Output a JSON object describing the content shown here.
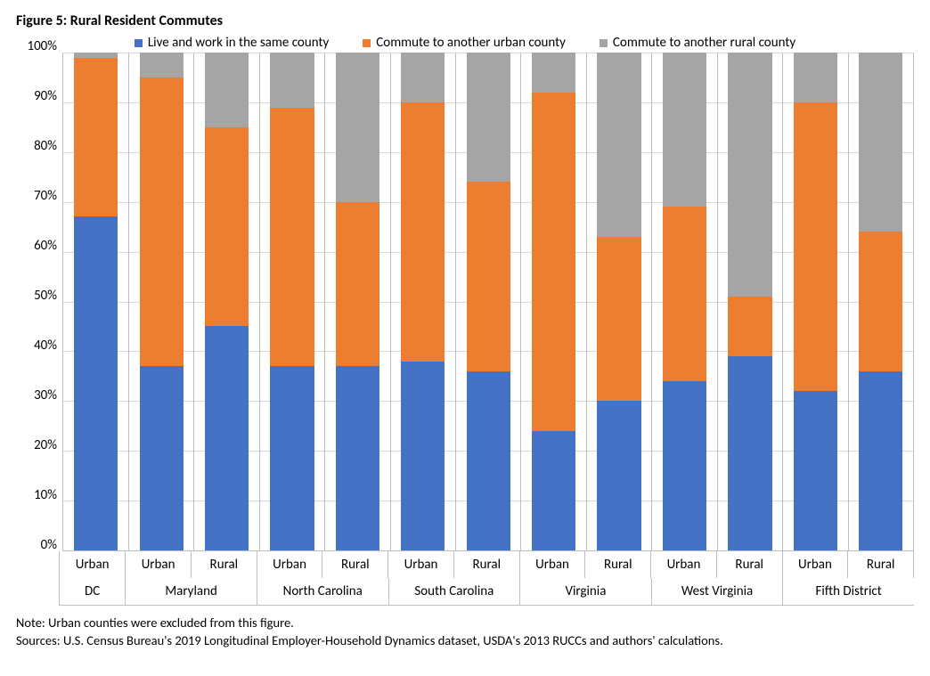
{
  "title": "Figure 5: Rural Resident Commutes",
  "legend": [
    {
      "label": "Live and work in the same county",
      "color": "#4472C4",
      "class": "c-blue"
    },
    {
      "label": "Commute to another urban county",
      "color": "#ED7D31",
      "class": "c-orange"
    },
    {
      "label": "Commute to another rural county",
      "color": "#A5A5A5",
      "class": "c-gray"
    }
  ],
  "y_ticks": [
    "100%",
    "90%",
    "80%",
    "70%",
    "60%",
    "50%",
    "40%",
    "30%",
    "20%",
    "10%",
    "0%"
  ],
  "note": "Note: Urban counties were excluded from this figure.",
  "source": "Sources: U.S. Census Bureau's 2019 Longitudinal Employer-Household Dynamics dataset, USDA's 2013 RUCCs and authors' calculations.",
  "chart_data": {
    "type": "bar",
    "stacked": true,
    "ylabel": "",
    "xlabel": "",
    "ylim": [
      0,
      100
    ],
    "series_names": [
      "Live and work in the same county",
      "Commute to another urban county",
      "Commute to another rural county"
    ],
    "groups": [
      {
        "state": "DC",
        "bars": [
          {
            "sub": "Urban",
            "values": [
              67,
              32,
              1
            ]
          }
        ]
      },
      {
        "state": "Maryland",
        "bars": [
          {
            "sub": "Urban",
            "values": [
              37,
              58,
              5
            ]
          },
          {
            "sub": "Rural",
            "values": [
              45,
              40,
              15
            ]
          }
        ]
      },
      {
        "state": "North Carolina",
        "bars": [
          {
            "sub": "Urban",
            "values": [
              37,
              52,
              11
            ]
          },
          {
            "sub": "Rural",
            "values": [
              37,
              33,
              30
            ]
          }
        ]
      },
      {
        "state": "South Carolina",
        "bars": [
          {
            "sub": "Urban",
            "values": [
              38,
              52,
              10
            ]
          },
          {
            "sub": "Rural",
            "values": [
              36,
              38,
              26
            ]
          }
        ]
      },
      {
        "state": "Virginia",
        "bars": [
          {
            "sub": "Urban",
            "values": [
              24,
              68,
              8
            ]
          },
          {
            "sub": "Rural",
            "values": [
              30,
              33,
              37
            ]
          }
        ]
      },
      {
        "state": "West Virginia",
        "bars": [
          {
            "sub": "Urban",
            "values": [
              34,
              35,
              31
            ]
          },
          {
            "sub": "Rural",
            "values": [
              39,
              12,
              49
            ]
          }
        ]
      },
      {
        "state": "Fifth District",
        "bars": [
          {
            "sub": "Urban",
            "values": [
              32,
              58,
              10
            ]
          },
          {
            "sub": "Rural",
            "values": [
              36,
              28,
              36
            ]
          }
        ]
      }
    ]
  }
}
